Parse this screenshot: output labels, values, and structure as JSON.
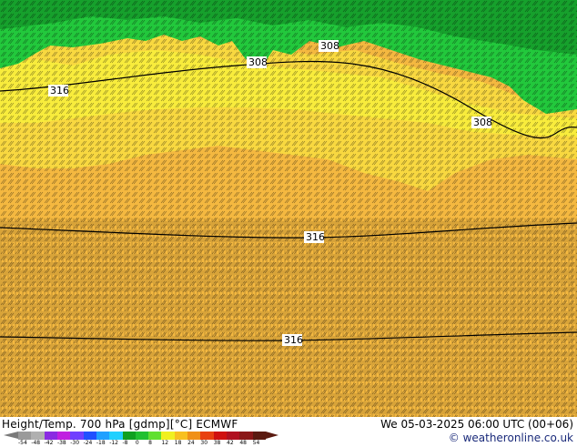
{
  "map": {
    "colors": {
      "warm_fill": "#f4b840",
      "mid_fill": "#f8d840",
      "north_fill": "#f8ec3c",
      "green_fill": "#22c83c",
      "dark_green_fill": "#16a02c",
      "contour_line": "#000000"
    },
    "contour_labels": [
      {
        "id": "c1",
        "text": "308"
      },
      {
        "id": "c2",
        "text": "308"
      },
      {
        "id": "c3",
        "text": "316"
      },
      {
        "id": "c4",
        "text": "308"
      },
      {
        "id": "c5",
        "text": "316"
      },
      {
        "id": "c6",
        "text": "316"
      }
    ]
  },
  "footer": {
    "title": "Height/Temp. 700 hPa [gdmp][°C] ECMWF",
    "date": "We 05-03-2025 06:00 UTC (00+06)",
    "credit": "© weatheronline.co.uk",
    "scale_ticks": [
      "-54",
      "-48",
      "-42",
      "-38",
      "-30",
      "-24",
      "-18",
      "-12",
      "-8",
      "0",
      "8",
      "12",
      "18",
      "24",
      "30",
      "38",
      "42",
      "48",
      "54"
    ],
    "scale_colors": [
      "#9a9a9a",
      "#b0b0b0",
      "#8a2be2",
      "#c020e0",
      "#7040ff",
      "#2050ff",
      "#20a0ff",
      "#20d0ff",
      "#10a020",
      "#20c030",
      "#60e030",
      "#f0f020",
      "#f8c020",
      "#f09018",
      "#e84010",
      "#d01010",
      "#b01020",
      "#8a1818",
      "#5a1a10"
    ]
  }
}
